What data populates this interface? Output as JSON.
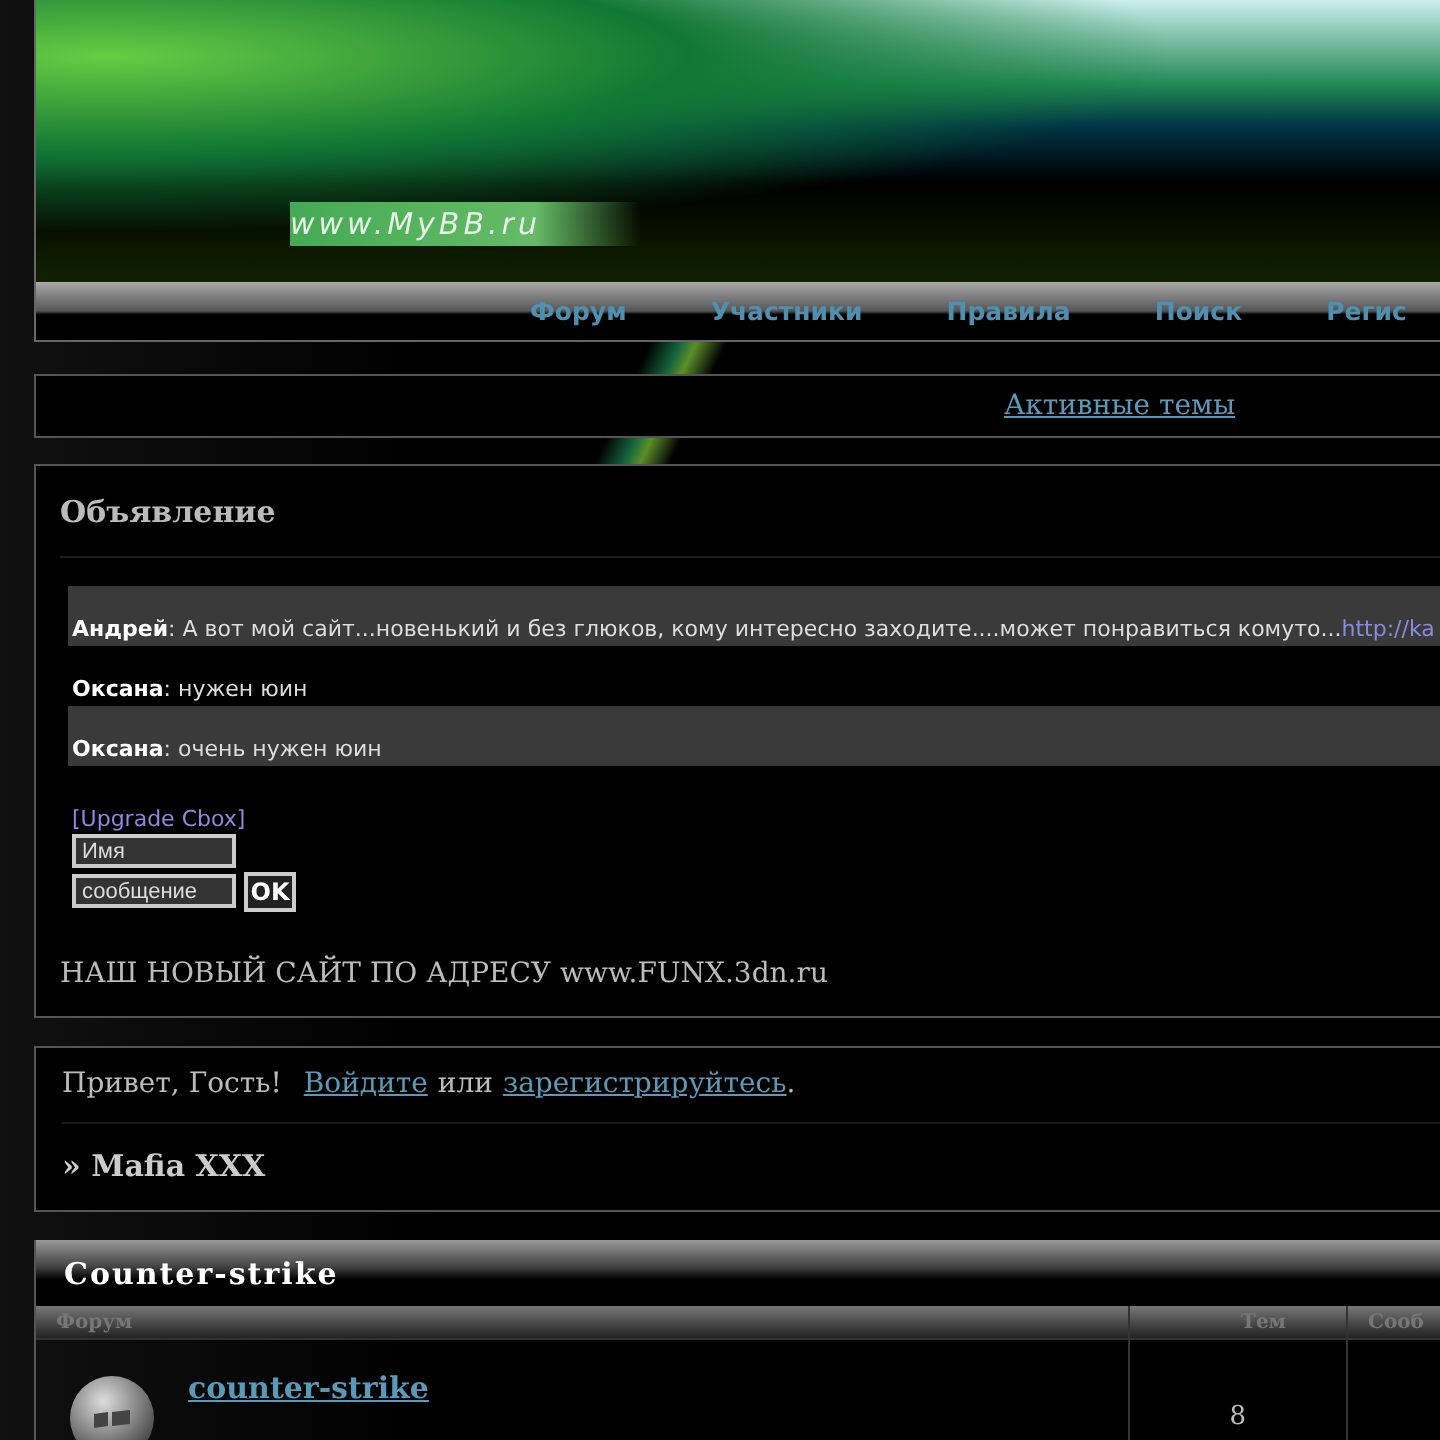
{
  "header": {
    "logo": "www.MyBB.ru"
  },
  "nav": [
    "Форум",
    "Участники",
    "Правила",
    "Поиск",
    "Регис"
  ],
  "active_topics": "Активные темы",
  "announcement": {
    "title": "Объявление",
    "chat": [
      {
        "author": "Андрей",
        "text": ": А вот мой сайт...новенький и без глюков, кому интересно заходите....может понравиться комуто... ",
        "link": "http://ka",
        "shaded": true
      },
      {
        "author": "Оксана",
        "text": ": нужен юин",
        "shaded": false
      },
      {
        "author": "Оксана",
        "text": ": очень нужен юин",
        "shaded": true
      }
    ],
    "upgrade_link": "[Upgrade Cbox]",
    "name_placeholder": "Имя",
    "message_placeholder": "сообщение",
    "ok": "OK",
    "notice": "НАШ НОВЫЙ САЙТ ПО АДРЕСУ www.FUNX.3dn.ru"
  },
  "welcome": {
    "greeting": "Привет, Гость!",
    "login": "Войдите",
    "or": "или",
    "register": "зарегистрируйтесь",
    "period": ".",
    "board_title": "» Mafia XXX"
  },
  "category": {
    "title": "Counter-strike",
    "columns": [
      "Форум",
      "Тем",
      "Сооб"
    ],
    "forums": [
      {
        "name": "counter-strike",
        "topics": "8"
      }
    ]
  }
}
